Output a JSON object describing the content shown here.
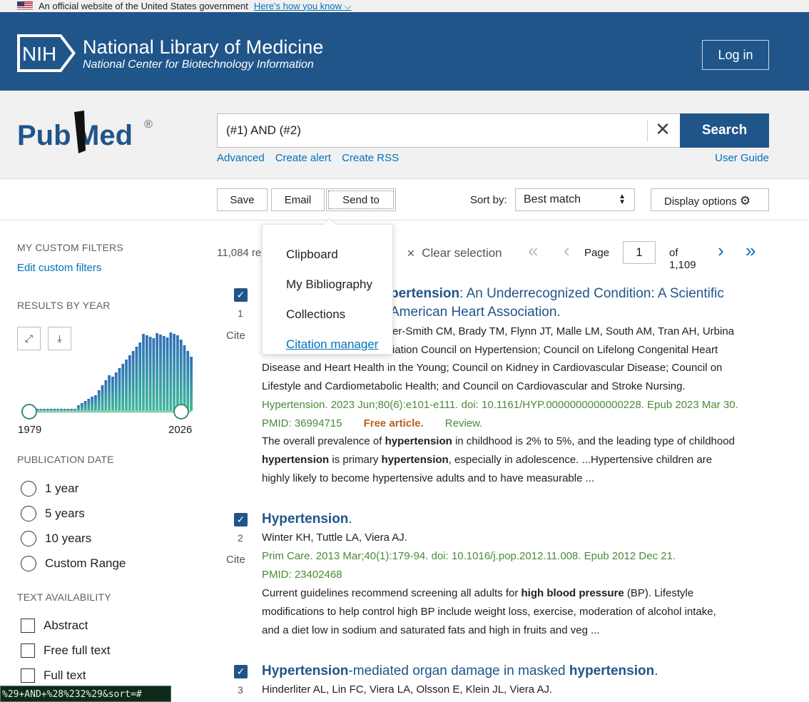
{
  "gov_banner": {
    "text": "An official website of the United States government",
    "link": "Here's how you know"
  },
  "nih": {
    "logo_text": "NIH",
    "title": "National Library of Medicine",
    "subtitle": "National Center for Biotechnology Information",
    "login_label": "Log in"
  },
  "search": {
    "logo_text_1": "Pub",
    "logo_text_2": "Med",
    "logo_reg": "®",
    "query": "(#1) AND (#2)",
    "clear_glyph": "✕",
    "search_label": "Search",
    "links": [
      "Advanced",
      "Create alert",
      "Create RSS"
    ],
    "user_guide": "User Guide"
  },
  "toolbar": {
    "save": "Save",
    "email": "Email",
    "send_to": "Send to",
    "sort_label": "Sort by:",
    "sort_value": "Best match",
    "display_options": "Display options"
  },
  "send_to_menu": [
    "Clipboard",
    "My Bibliography",
    "Collections",
    "Citation manager"
  ],
  "sidebar": {
    "custom_filters_head": "MY CUSTOM FILTERS",
    "edit_filters": "Edit custom filters",
    "results_by_year_head": "RESULTS BY YEAR",
    "year_start": "1979",
    "year_end": "2026",
    "pub_date_head": "PUBLICATION DATE",
    "pub_date_options": [
      "1 year",
      "5 years",
      "10 years",
      "Custom Range"
    ],
    "text_avail_head": "TEXT AVAILABILITY",
    "text_avail_options": [
      "Abstract",
      "Free full text",
      "Full text"
    ]
  },
  "results": {
    "count": "11,084 re",
    "clear_selection": "Clear selection",
    "page_label": "Page",
    "page_value": "1",
    "of_pages": "of 1,109"
  },
  "articles": [
    {
      "num": "1",
      "cite": "Cite",
      "title_hl": "pertension",
      "title_rest": ": An Underrecognized Condition: A Scientific",
      "title_line2": "American Heart Association.",
      "authors": "er-Smith CM, Brady TM, Flynn JT, Malle LM, South AM, Tran AH, Urbina",
      "authors2": "iation Council on Hypertension; Council on Lifelong Congenital Heart",
      "authors3": "Disease and Heart Health in the Young; Council on Kidney in Cardiovascular Disease; Council on",
      "authors4": "Lifestyle and Cardiometabolic Health; and Council on Cardiovascular and Stroke Nursing.",
      "journal": "Hypertension. 2023 Jun;80(6):e101-e111. doi: 10.1161/HYP.0000000000000228. Epub 2023 Mar 30.",
      "pmid": "PMID: 36994715",
      "free": "Free article.",
      "type": "Review.",
      "snip1_a": "The overall prevalence of ",
      "snip1_b": "hypertension",
      "snip1_c": " in childhood is 2% to 5%, and the leading type of childhood",
      "snip2_a": "hypertension",
      "snip2_b": " is primary ",
      "snip2_c": "hypertension",
      "snip2_d": ", especially in adolescence. ...Hypertensive children are",
      "snip3": "highly likely to become hypertensive adults and to have measurable ..."
    },
    {
      "num": "2",
      "cite": "Cite",
      "title_hl": "Hypertension",
      "title_rest": ".",
      "authors": "Winter KH, Tuttle LA, Viera AJ.",
      "journal": "Prim Care. 2013 Mar;40(1):179-94. doi: 10.1016/j.pop.2012.11.008. Epub 2012 Dec 21.",
      "pmid": "PMID: 23402468",
      "snip1_a": "Current guidelines recommend screening all adults for ",
      "snip1_b": "high blood pressure",
      "snip1_c": " (BP). Lifestyle",
      "snip2": "modifications to help control high BP include weight loss, exercise, moderation of alcohol intake,",
      "snip3": "and a diet low in sodium and saturated fats and high in fruits and veg ..."
    },
    {
      "num": "3",
      "title_hl": "Hypertension",
      "title_mid": "-mediated organ damage in masked ",
      "title_hl2": "hypertension",
      "title_end": ".",
      "authors": "Hinderliter AL, Lin FC, Viera LA, Olsson E, Klein JL, Viera AJ."
    }
  ],
  "status_url": "%29+AND+%28%232%29&sort=#",
  "colors": {
    "nih_blue": "#20558a",
    "link_blue": "#0071bc",
    "journal_green": "#4a8b3a",
    "free_orange": "#b85f1c"
  }
}
